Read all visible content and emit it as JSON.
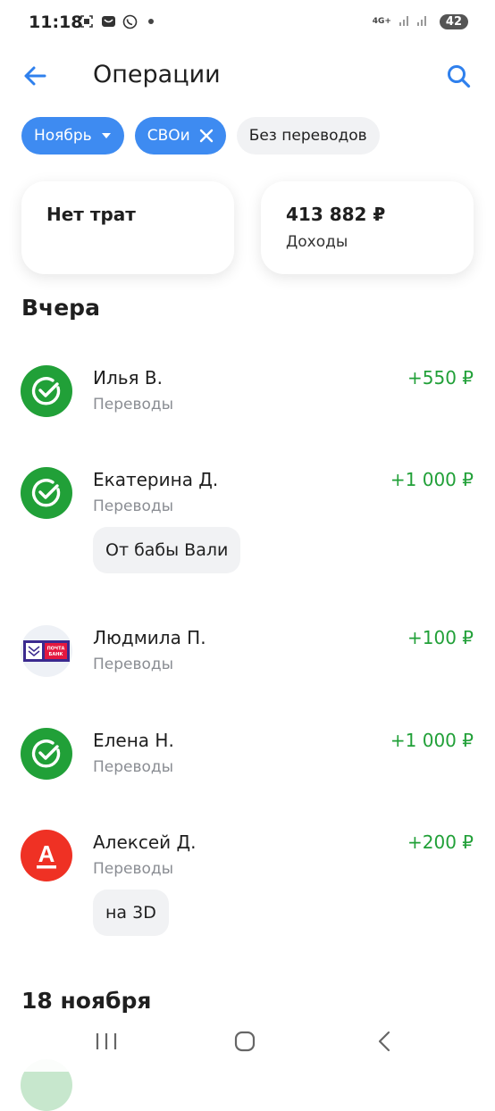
{
  "status_bar": {
    "time": "11:18",
    "network": "4G+",
    "battery": "42"
  },
  "header": {
    "title": "Операции"
  },
  "filters": {
    "month": "Ноябрь",
    "tag": "СВОи",
    "transfers": "Без переводов"
  },
  "summary": {
    "expenses": "Нет трат",
    "income_amount": "413 882 ₽",
    "income_label": "Доходы"
  },
  "sections": {
    "yesterday": "Вчера",
    "nov18": "18 ноября"
  },
  "transactions": [
    {
      "name": "Илья В.",
      "category": "Переводы",
      "amount": "+550 ₽",
      "bank": "sber"
    },
    {
      "name": "Екатерина Д.",
      "category": "Переводы",
      "amount": "+1 000 ₽",
      "bank": "sber",
      "note": "От бабы Вали"
    },
    {
      "name": "Людмила П.",
      "category": "Переводы",
      "amount": "+100 ₽",
      "bank": "pochta",
      "logo_text": "ПОЧТА БАНК"
    },
    {
      "name": "Елена Н.",
      "category": "Переводы",
      "amount": "+1 000 ₽",
      "bank": "sber"
    },
    {
      "name": "Алексей Д.",
      "category": "Переводы",
      "amount": "+200 ₽",
      "bank": "alfa",
      "logo_text": "А",
      "note": "на 3D"
    }
  ],
  "colors": {
    "accent": "#3e8bf1",
    "income": "#21a038",
    "sber": "#21a038",
    "alfa": "#ef3124",
    "pochta": "#3b2a8f"
  },
  "icons": {
    "back": "arrow-left-icon",
    "search": "search-icon",
    "dropdown": "caret-down-icon",
    "clear": "close-icon"
  }
}
